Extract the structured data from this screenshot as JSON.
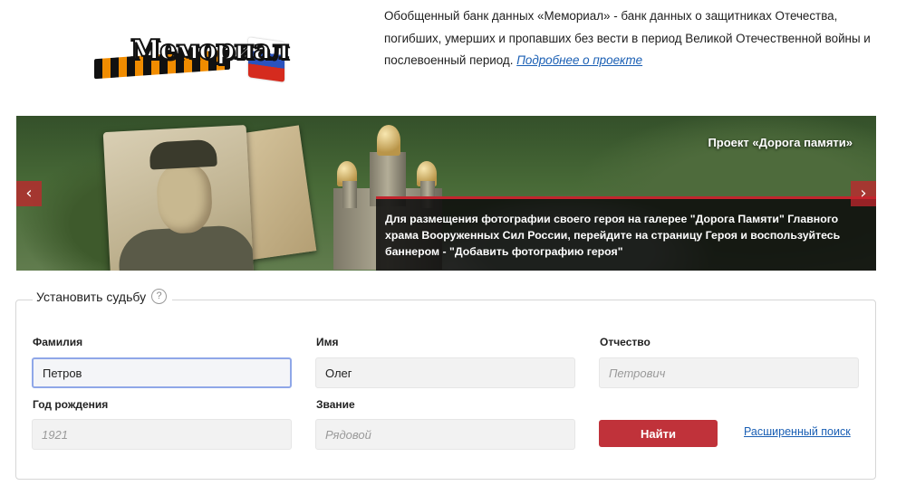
{
  "header": {
    "logo_text": "Мемориал",
    "about_text": "Обобщенный банк данных «Мемориал» - банк данных о защитниках Отечества, погибших, умерших и пропавших без вести в период Великой Отечественной войны и послевоенный период.",
    "about_link": "Подробнее о проекте"
  },
  "banner": {
    "title": "Проект «Дорога памяти»",
    "caption": "Для размещения фотографии своего героя на галерее \"Дорога Памяти\" Главного храма Вооруженных Сил России, перейдите на страницу Героя и воспользуйтесь баннером - \"Добавить фотографию героя\"",
    "prev_arrow": "‹",
    "next_arrow": "›"
  },
  "search": {
    "legend": "Установить судьбу",
    "help_glyph": "?",
    "fields": {
      "last_name": {
        "label": "Фамилия",
        "value": "Петров",
        "placeholder": ""
      },
      "first_name": {
        "label": "Имя",
        "value": "Олег",
        "placeholder": ""
      },
      "patronymic": {
        "label": "Отчество",
        "value": "",
        "placeholder": "Петрович"
      },
      "birth_year": {
        "label": "Год рождения",
        "value": "",
        "placeholder": "1921"
      },
      "rank": {
        "label": "Звание",
        "value": "",
        "placeholder": "Рядовой"
      }
    },
    "submit_label": "Найти",
    "advanced_link": "Расширенный поиск"
  },
  "colors": {
    "accent_red": "#c0323a",
    "link_blue": "#1a5fb4",
    "focus_border": "#8fa7e8"
  }
}
